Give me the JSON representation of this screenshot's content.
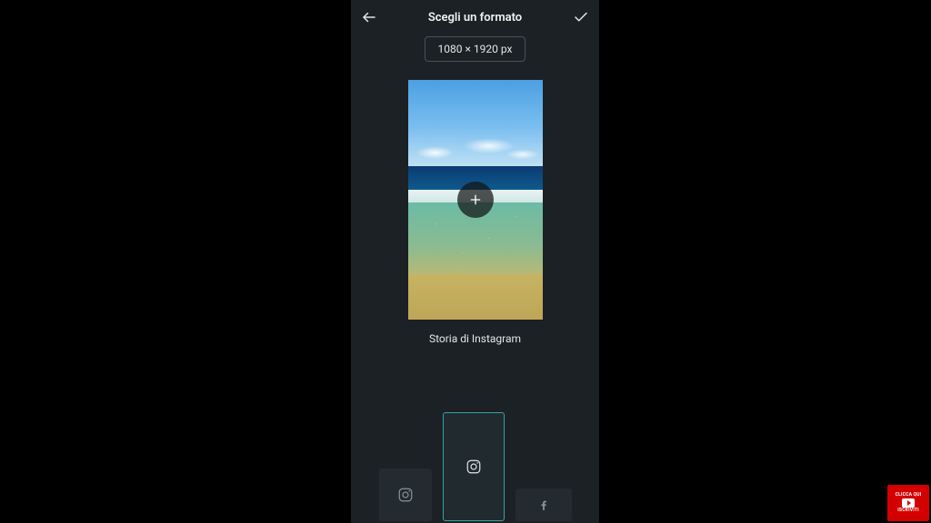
{
  "header": {
    "title": "Scegli un formato"
  },
  "dimensions": {
    "label": "1080 × 1920 px"
  },
  "preview": {
    "label": "Storia di Instagram"
  },
  "subscribe": {
    "top": "CLICCA QUI",
    "bottom": "ISCRIVITI"
  },
  "colors": {
    "accent": "#3aa0a6",
    "panel": "#1b2125",
    "card": "#242b30",
    "badge": "#d40000"
  }
}
